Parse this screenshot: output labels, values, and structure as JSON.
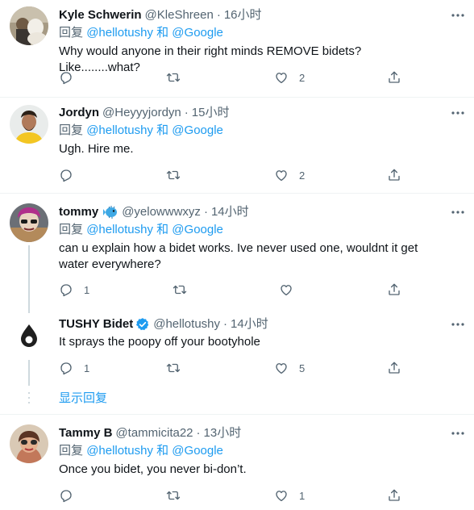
{
  "replies": [
    {
      "name": "Kyle Schwerin",
      "handle": "@KleShreen",
      "time": "16小时",
      "reply_prefix": "回复",
      "mentions": "@hellotushy 和 @Google",
      "text": "Why would anyone in their right minds REMOVE bidets? Like........what?",
      "likes": "2",
      "retweets": "",
      "reply_count": ""
    },
    {
      "name": "Jordyn",
      "handle": "@Heyyyjordyn",
      "time": "15小时",
      "reply_prefix": "回复",
      "mentions": "@hellotushy 和 @Google",
      "text": "Ugh. Hire me.",
      "likes": "2",
      "retweets": "",
      "reply_count": ""
    },
    {
      "name": "tommy",
      "handle": "@yelowwwxyz",
      "time": "14小时",
      "reply_prefix": "回复",
      "mentions": "@hellotushy 和 @Google",
      "text": "can u explain how a bidet works. Ive never used one, wouldnt it get water everywhere?",
      "likes": "",
      "retweets": "",
      "reply_count": "1"
    },
    {
      "name": "TUSHY Bidet",
      "handle": "@hellotushy",
      "time": "14小时",
      "text": "It sprays the poopy off your bootyhole",
      "likes": "5",
      "retweets": "",
      "reply_count": "1"
    },
    {
      "name": "Tammy B",
      "handle": "@tammicita22",
      "time": "13小时",
      "reply_prefix": "回复",
      "mentions": "@hellotushy 和 @Google",
      "text": "Once you bidet, you never bi-don’t.",
      "likes": "1",
      "retweets": "",
      "reply_count": ""
    }
  ],
  "show_replies_label": "显示回复",
  "separator": "·",
  "colors": {
    "accent": "#1d9bf0",
    "secondary_text": "#536471",
    "primary_text": "#0f1419",
    "verified": "#1d9bf0",
    "divider": "#eff3f4"
  },
  "icons": {
    "reply": "reply-icon",
    "retweet": "retweet-icon",
    "like": "like-icon",
    "share": "share-icon",
    "more": "more-icon",
    "verified": "verified-badge-icon",
    "fish": "blowfish-emoji"
  }
}
